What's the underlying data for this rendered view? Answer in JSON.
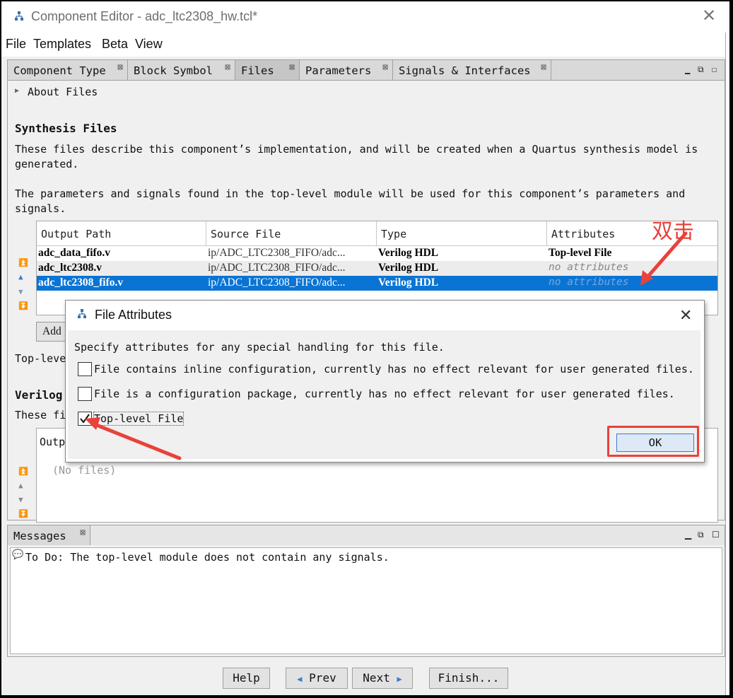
{
  "window": {
    "title": "Component Editor - adc_ltc2308_hw.tcl*"
  },
  "menu": [
    "File",
    "Templates",
    "Beta",
    "View"
  ],
  "tabs": [
    {
      "label": "Component Type"
    },
    {
      "label": "Block Symbol"
    },
    {
      "label": "Files"
    },
    {
      "label": "Parameters"
    },
    {
      "label": "Signals & Interfaces"
    }
  ],
  "files": {
    "about": "About Files",
    "synthesis_heading": "Synthesis Files",
    "synthesis_desc_1": "These files describe this component’s implementation, and will be created when a Quartus synthesis model is",
    "synthesis_desc_2": "generated.",
    "param_desc_1": "The parameters and signals found in the top-level module will be used for this component’s parameters and",
    "param_desc_2": "signals.",
    "columns": [
      "Output Path",
      "Source File",
      "Type",
      "Attributes"
    ],
    "rows": [
      {
        "output": "adc_data_fifo.v",
        "source": "ip/ADC_LTC2308_FIFO/adc...",
        "type": "Verilog HDL",
        "attributes": "Top-level File"
      },
      {
        "output": "adc_ltc2308.v",
        "source": "ip/ADC_LTC2308_FIFO/adc...",
        "type": "Verilog HDL",
        "attributes": "no attributes"
      },
      {
        "output": "adc_ltc2308_fifo.v",
        "source": "ip/ADC_LTC2308_FIFO/adc...",
        "type": "Verilog HDL",
        "attributes": "no attributes"
      }
    ],
    "add_label": "Add",
    "toplevel_partial": "Top-level",
    "verilog_heading_partial": "Verilog",
    "verilog_desc_partial": "These fi",
    "verilog_col_partial": "Outp",
    "no_files": "(No files)"
  },
  "annotation": {
    "double_click": "双击"
  },
  "dialog": {
    "title": "File Attributes",
    "prompt": "Specify attributes for any special handling for this file.",
    "options": [
      {
        "label": "File contains inline configuration, currently has no effect relevant for user generated files.",
        "checked": false
      },
      {
        "label": "File is a configuration package, currently has no effect relevant for user generated files.",
        "checked": false
      },
      {
        "label": "Top-level File",
        "checked": true
      }
    ],
    "ok": "OK"
  },
  "messages": {
    "tab": "Messages",
    "items": [
      "To Do: The top-level module does not contain any signals."
    ]
  },
  "buttons": {
    "help": "Help",
    "prev": "Prev",
    "next": "Next",
    "finish": "Finish..."
  },
  "colors": {
    "selection": "#0a74d4",
    "annotation_red": "#e8423b"
  }
}
